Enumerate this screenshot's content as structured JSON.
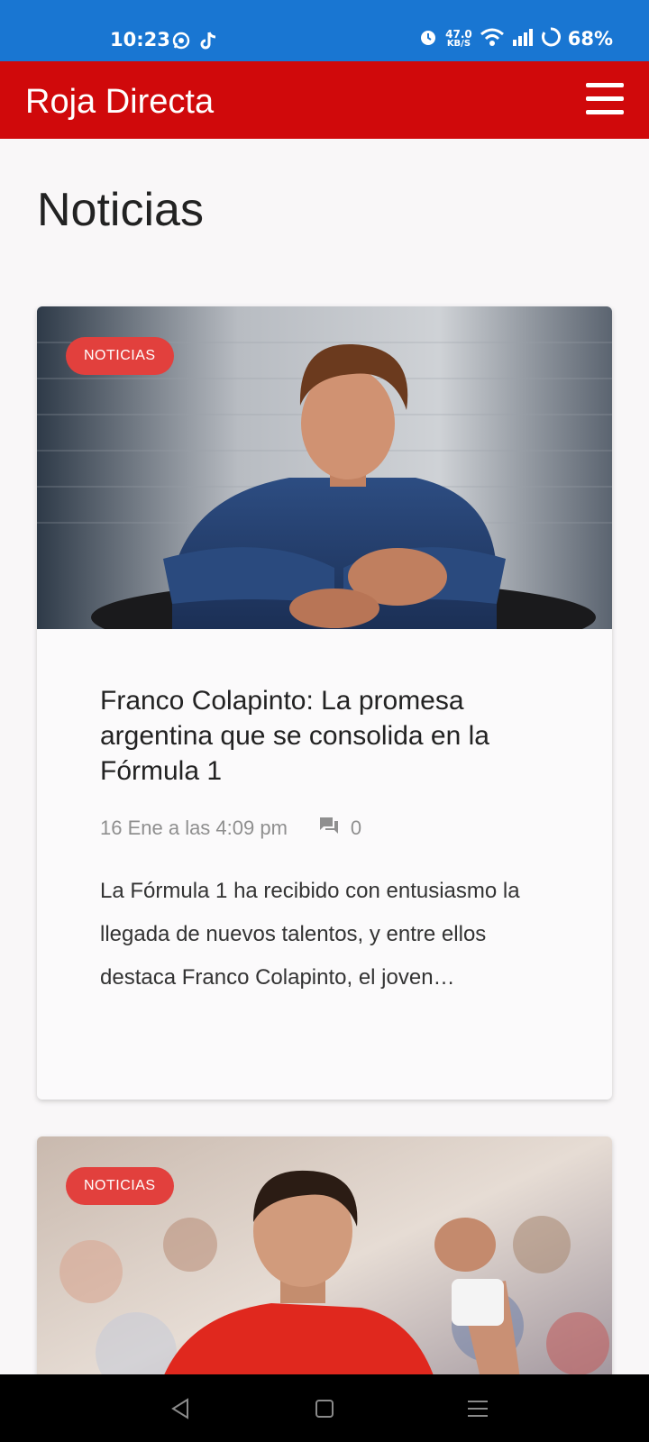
{
  "status_bar": {
    "time": "10:23",
    "speed_value": "47.0",
    "speed_unit": "KB/S",
    "battery": "68%",
    "icons": [
      "whatsapp-icon",
      "tiktok-icon",
      "alarm-icon",
      "wifi-icon",
      "signal-icon",
      "battery-icon"
    ]
  },
  "app_bar": {
    "title": "Roja Directa",
    "background": "#d0090b",
    "menu_icon": "hamburger-menu-icon"
  },
  "page": {
    "title": "Noticias"
  },
  "articles": [
    {
      "category": "NOTICIAS",
      "image": "driver-portrait-photo",
      "title": "Franco Colapinto: La promesa argentina que se consolida en la Fórmula 1",
      "date": "16 Ene a las 4:09 pm",
      "comments": "0",
      "excerpt": "La Fórmula 1 ha recibido con entusiasmo la llegada de nuevos talentos, y entre ellos destaca Franco Colapinto, el joven…"
    },
    {
      "category": "NOTICIAS",
      "image": "tennis-player-photo"
    }
  ],
  "nav_bar": {
    "icons": [
      "back-icon",
      "home-icon",
      "recents-icon"
    ]
  },
  "colors": {
    "status_bar": "#1976d2",
    "accent": "#d0090b",
    "badge": "#e2403d"
  }
}
